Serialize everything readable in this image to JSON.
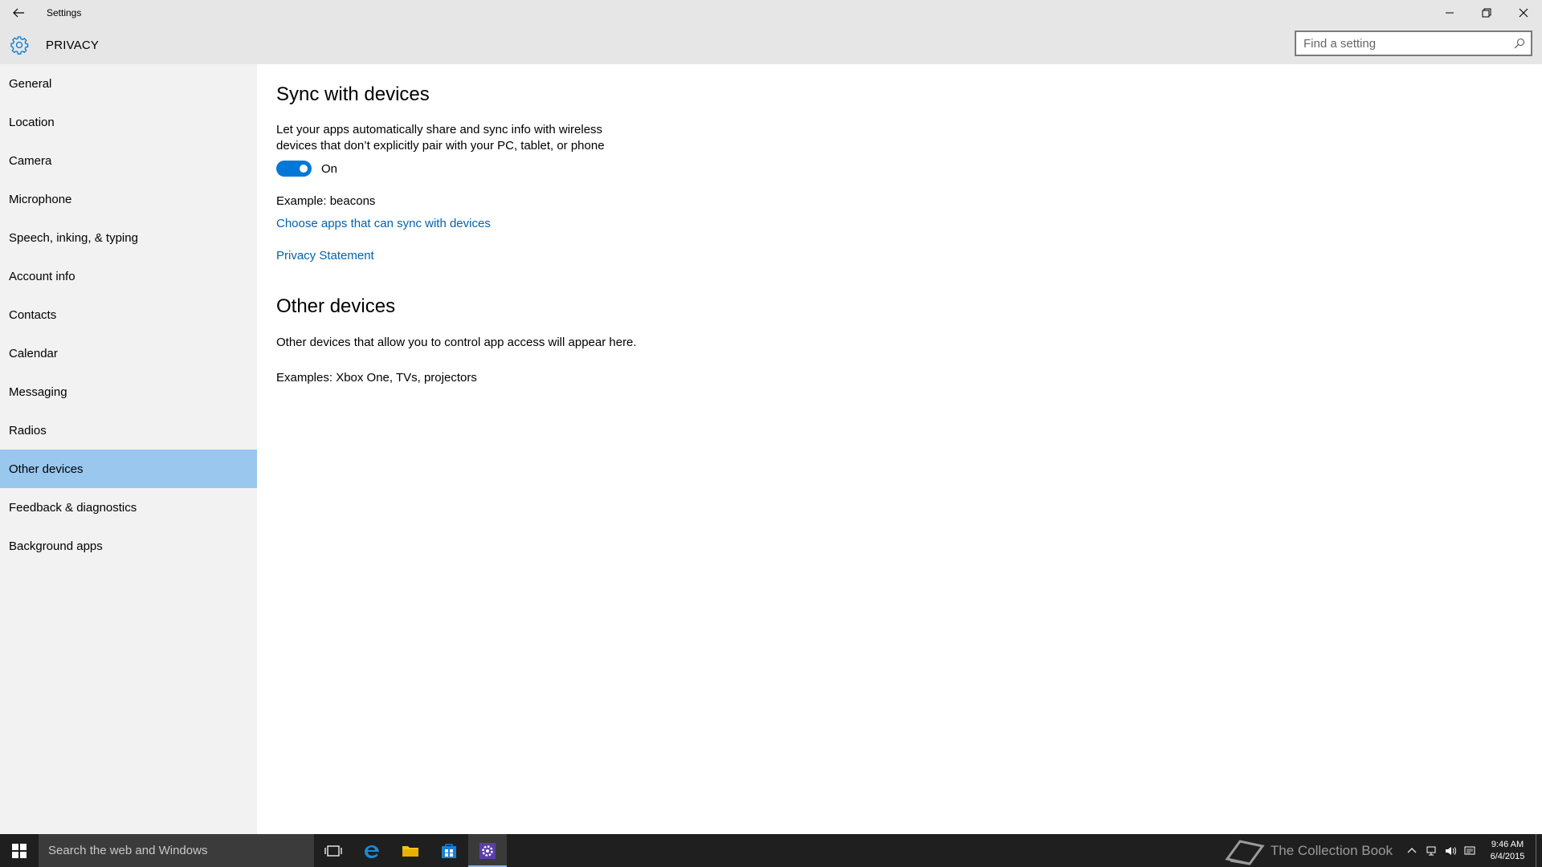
{
  "window": {
    "title": "Settings"
  },
  "header": {
    "page_title": "PRIVACY",
    "search_placeholder": "Find a setting"
  },
  "sidebar": {
    "items": [
      {
        "label": "General"
      },
      {
        "label": "Location"
      },
      {
        "label": "Camera"
      },
      {
        "label": "Microphone"
      },
      {
        "label": "Speech, inking, & typing"
      },
      {
        "label": "Account info"
      },
      {
        "label": "Contacts"
      },
      {
        "label": "Calendar"
      },
      {
        "label": "Messaging"
      },
      {
        "label": "Radios"
      },
      {
        "label": "Other devices",
        "selected": true
      },
      {
        "label": "Feedback & diagnostics"
      },
      {
        "label": "Background apps"
      }
    ]
  },
  "main": {
    "sync_title": "Sync with devices",
    "sync_description": "Let your apps automatically share and sync info with wireless devices that don’t explicitly pair with your PC, tablet, or phone",
    "toggle_state": "On",
    "example": "Example: beacons",
    "choose_apps_link": "Choose apps that can sync with devices",
    "privacy_statement_link": "Privacy Statement",
    "other_title": "Other devices",
    "other_description": "Other devices that allow you to control app access will appear here.",
    "other_examples": "Examples: Xbox One, TVs, projectors"
  },
  "taskbar": {
    "search_text": "Search the web and Windows",
    "watermark": "The Collection Book",
    "time": "9:46 AM",
    "date": "6/4/2015"
  },
  "colors": {
    "accent": "#0078d7",
    "selected_nav": "#99c7ee",
    "link": "#0063b1",
    "chrome": "#e6e6e6",
    "sidebar": "#f2f2f2",
    "taskbar": "#1f1f1f"
  }
}
